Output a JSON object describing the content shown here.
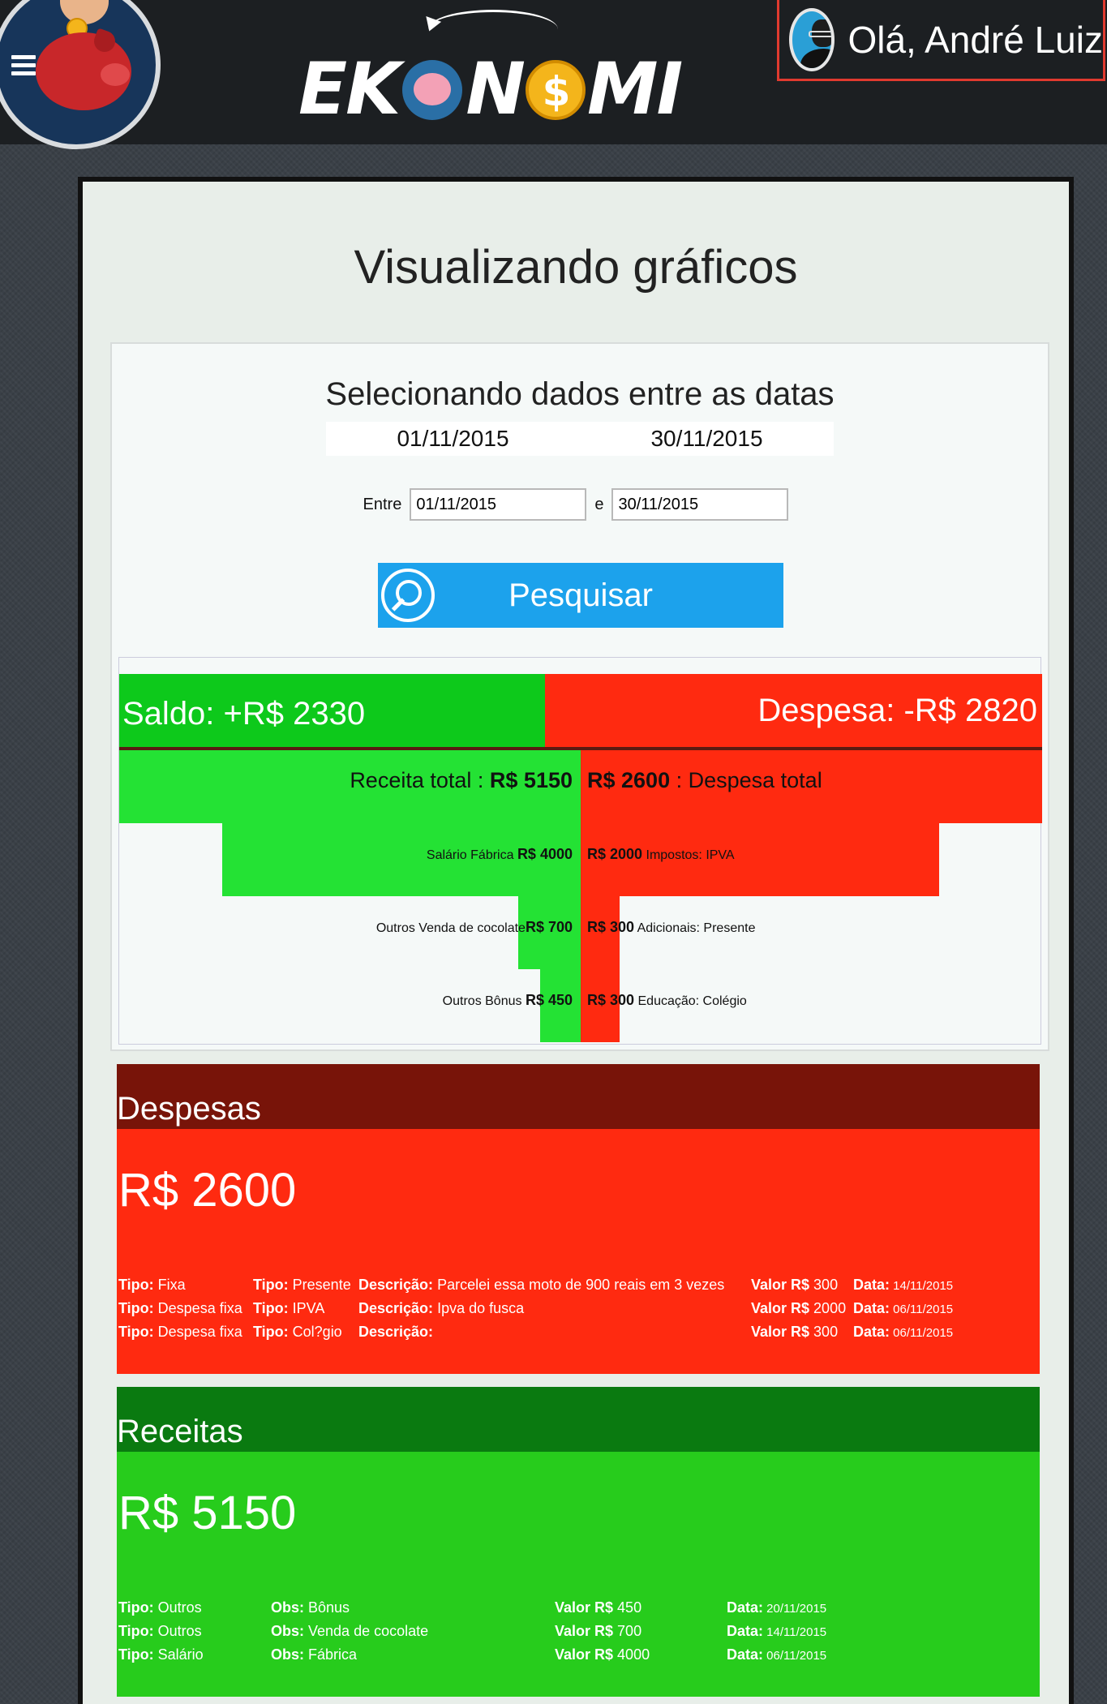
{
  "header": {
    "logo_text_pre": "EK",
    "logo_text_mid": "N",
    "logo_text_post": "MI",
    "logo_coin_symbol": "$",
    "greeting": "Olá, André Luiz"
  },
  "page": {
    "title": "Visualizando gráficos"
  },
  "date_filter": {
    "heading": "Selecionando dados entre as datas",
    "display_start": "01/11/2015",
    "display_end": "30/11/2015",
    "between_label": "Entre",
    "and_label": "e",
    "start_value": "01/11/2015",
    "end_value": "30/11/2015",
    "search_label": "Pesquisar"
  },
  "summary": {
    "saldo": "Saldo: +R$ 2330",
    "despesa": "Despesa: -R$ 2820"
  },
  "chart_data": {
    "type": "bar",
    "orientation": "horizontal-diverging",
    "title": "",
    "series": [
      {
        "name": "Receita",
        "color": "#24e234",
        "categories": [
          "Receita total",
          "Salário Fábrica",
          "Outros Venda de cocolate",
          "Outros Bônus"
        ],
        "values": [
          5150,
          4000,
          700,
          450
        ]
      },
      {
        "name": "Despesa",
        "color": "#ff2a10",
        "categories": [
          "Despesa total",
          "Impostos: IPVA",
          "Adicionais: Presente",
          "Educação: Colégio"
        ],
        "values": [
          2600,
          2000,
          300,
          300
        ]
      }
    ],
    "labels": {
      "receita_total_label": "Receita total : ",
      "receita_total_value": "R$ 5150",
      "despesa_total_value": "R$ 2600",
      "despesa_total_label": " : Despesa total",
      "rows": [
        {
          "left_label": "Salário Fábrica ",
          "left_value": "R$ 4000",
          "right_value": "R$ 2000",
          "right_label": " Impostos: IPVA"
        },
        {
          "left_label": "Outros Venda de cocolate",
          "left_value": "R$ 700",
          "right_value": "R$ 300",
          "right_label": " Adicionais: Presente"
        },
        {
          "left_label": "Outros Bônus ",
          "left_value": "R$ 450",
          "right_value": "R$ 300",
          "right_label": " Educação: Colégio"
        }
      ]
    }
  },
  "despesas": {
    "heading": "Despesas",
    "total": "R$ 2600",
    "rows": [
      {
        "tipo_label": "Tipo:",
        "tipo": " Fixa",
        "tipo2_label": "Tipo:",
        "tipo2": " Presente",
        "desc_label": "Descrição:",
        "desc": " Parcelei essa moto de 900 reais em 3 vezes",
        "valor_label": "Valor R$",
        "valor": " 300",
        "data_label": "Data:",
        "data": " 14/11/2015"
      },
      {
        "tipo_label": "Tipo:",
        "tipo": " Despesa fixa",
        "tipo2_label": "Tipo:",
        "tipo2": " IPVA",
        "desc_label": "Descrição:",
        "desc": " Ipva do fusca",
        "valor_label": "Valor R$",
        "valor": " 2000",
        "data_label": "Data:",
        "data": " 06/11/2015"
      },
      {
        "tipo_label": "Tipo:",
        "tipo": " Despesa fixa",
        "tipo2_label": "Tipo:",
        "tipo2": " Col?gio",
        "desc_label": "Descrição:",
        "desc": "",
        "valor_label": "Valor R$",
        "valor": " 300",
        "data_label": "Data:",
        "data": " 06/11/2015"
      }
    ]
  },
  "receitas": {
    "heading": "Receitas",
    "total": "R$ 5150",
    "rows": [
      {
        "tipo_label": "Tipo:",
        "tipo": " Outros",
        "obs_label": "Obs:",
        "obs": " Bônus",
        "valor_label": "Valor R$",
        "valor": " 450",
        "data_label": "Data:",
        "data": " 20/11/2015"
      },
      {
        "tipo_label": "Tipo:",
        "tipo": " Outros",
        "obs_label": "Obs:",
        "obs": " Venda de cocolate",
        "valor_label": "Valor R$",
        "valor": " 700",
        "data_label": "Data:",
        "data": " 14/11/2015"
      },
      {
        "tipo_label": "Tipo:",
        "tipo": " Salário",
        "obs_label": "Obs:",
        "obs": " Fábrica",
        "valor_label": "Valor R$",
        "valor": " 4000",
        "data_label": "Data:",
        "data": " 06/11/2015"
      }
    ]
  },
  "icons": {
    "menu": "hamburger-menu-icon",
    "search": "search-icon",
    "avatar": "user-avatar-icon"
  },
  "colors": {
    "receita": "#24e234",
    "despesa": "#ff2a10",
    "despesas_header": "#781409",
    "receitas_header": "#0a7a10",
    "search_button": "#1ca2ec"
  }
}
